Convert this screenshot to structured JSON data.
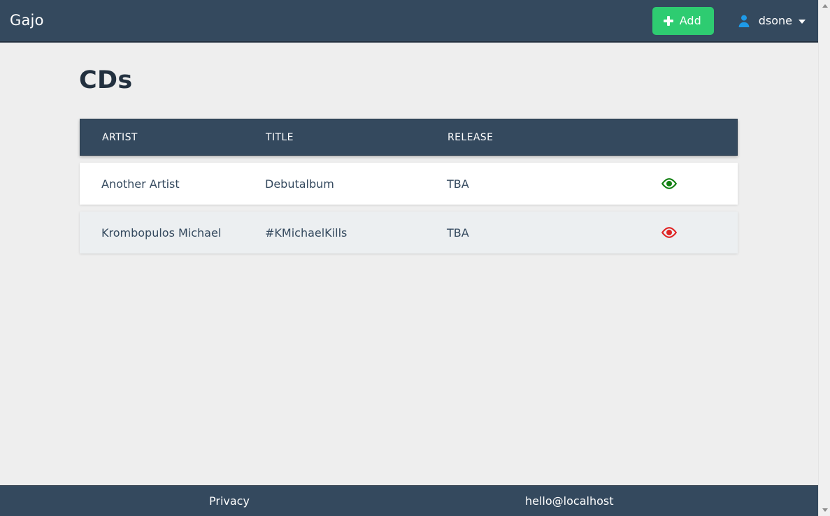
{
  "navbar": {
    "brand": "Gajo",
    "add_button_label": "Add",
    "add_icon": "plus-icon",
    "user_icon": "user-icon",
    "username": "dsone",
    "caret_icon": "chevron-down-icon",
    "background_color": "#34495e"
  },
  "main": {
    "page_title": "CDs",
    "table": {
      "columns": [
        "ARTIST",
        "TITLE",
        "RELEASE",
        ""
      ],
      "rows": [
        {
          "artist": "Another Artist",
          "title": "Debutalbum",
          "release": "TBA",
          "action_icon": "eye-icon",
          "action_color": "#128012"
        },
        {
          "artist": "Krombopulos Michael",
          "title": "#KMichaelKills",
          "release": "TBA",
          "action_icon": "eye-icon",
          "action_color": "#e02424"
        }
      ]
    }
  },
  "footer": {
    "privacy_label": "Privacy",
    "email_label": "hello@localhost"
  },
  "scrollbar": {
    "up_icon": "scroll-up-arrow-icon",
    "down_icon": "scroll-down-arrow-icon"
  }
}
